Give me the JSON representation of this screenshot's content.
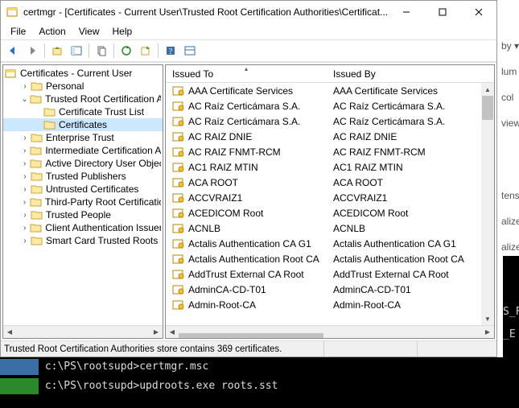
{
  "title": "certmgr - [Certificates - Current User\\Trusted Root Certification Authorities\\Certificat...",
  "menu": [
    "File",
    "Action",
    "View",
    "Help"
  ],
  "tree": {
    "root": "Certificates - Current User",
    "nodes": [
      {
        "expand": ">",
        "label": "Personal",
        "indent": 1
      },
      {
        "expand": "v",
        "label": "Trusted Root Certification Au",
        "indent": 1
      },
      {
        "expand": "",
        "label": "Certificate Trust List",
        "indent": 2
      },
      {
        "expand": "",
        "label": "Certificates",
        "indent": 2,
        "selected": true
      },
      {
        "expand": ">",
        "label": "Enterprise Trust",
        "indent": 1
      },
      {
        "expand": ">",
        "label": "Intermediate Certification Au",
        "indent": 1
      },
      {
        "expand": ">",
        "label": "Active Directory User Object",
        "indent": 1
      },
      {
        "expand": ">",
        "label": "Trusted Publishers",
        "indent": 1
      },
      {
        "expand": ">",
        "label": "Untrusted Certificates",
        "indent": 1
      },
      {
        "expand": ">",
        "label": "Third-Party Root Certification",
        "indent": 1
      },
      {
        "expand": ">",
        "label": "Trusted People",
        "indent": 1
      },
      {
        "expand": ">",
        "label": "Client Authentication Issuers",
        "indent": 1
      },
      {
        "expand": ">",
        "label": "Smart Card Trusted Roots",
        "indent": 1
      }
    ]
  },
  "list": {
    "columns": [
      "Issued To",
      "Issued By"
    ],
    "rows": [
      [
        "AAA Certificate Services",
        "AAA Certificate Services"
      ],
      [
        "AC Raíz Certicámara S.A.",
        "AC Raíz Certicámara S.A."
      ],
      [
        "AC Raíz Certicámara S.A.",
        "AC Raíz Certicámara S.A."
      ],
      [
        "AC RAIZ DNIE",
        "AC RAIZ DNIE"
      ],
      [
        "AC RAIZ FNMT-RCM",
        "AC RAIZ FNMT-RCM"
      ],
      [
        "AC1 RAIZ MTIN",
        "AC1 RAIZ MTIN"
      ],
      [
        "ACA ROOT",
        "ACA ROOT"
      ],
      [
        "ACCVRAIZ1",
        "ACCVRAIZ1"
      ],
      [
        "ACEDICOM Root",
        "ACEDICOM Root"
      ],
      [
        "ACNLB",
        "ACNLB"
      ],
      [
        "Actalis Authentication CA G1",
        "Actalis Authentication CA G1"
      ],
      [
        "Actalis Authentication Root CA",
        "Actalis Authentication Root CA"
      ],
      [
        "AddTrust External CA Root",
        "AddTrust External CA Root"
      ],
      [
        "AdminCA-CD-T01",
        "AdminCA-CD-T01"
      ],
      [
        "Admin-Root-CA",
        "Admin-Root-CA"
      ]
    ]
  },
  "status": "Trusted Root Certification Authorities store contains 369 certificates.",
  "behind_words": [
    "by ▾",
    "lum",
    "col",
    "view",
    "",
    "",
    "",
    "tens",
    "alize",
    "alize"
  ],
  "console": {
    "line1_prompt": "c:\\PS\\rootsupd>",
    "line1_cmd": "certmgr.msc",
    "line2_prompt": "c:\\PS\\rootsupd>",
    "line2_cmd": "updroots.exe roots.sst",
    "side1": "S_F",
    "side2": "_E"
  }
}
